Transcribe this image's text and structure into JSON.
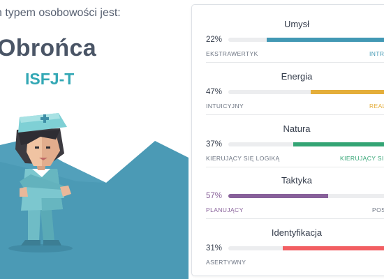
{
  "hero": {
    "intro": "n typem osobowości jest:",
    "type_name": "Obrońca",
    "type_code": "ISFJ-T"
  },
  "colors": {
    "teal": "#33a8b5",
    "blue": "#4298b4",
    "yellow": "#e4ae3a",
    "green": "#33a474",
    "purple": "#88619a",
    "red": "#f25e62"
  },
  "traits": [
    {
      "title": "Umysł",
      "percent": "22%",
      "value": 0.22,
      "left": "EKSTRAWERTYK",
      "right": "INTR",
      "color": "#4298b4",
      "active_side": "right"
    },
    {
      "title": "Energia",
      "percent": "47%",
      "value": 0.47,
      "left": "INTUICYJNY",
      "right": "REAL",
      "color": "#e4ae3a",
      "active_side": "right"
    },
    {
      "title": "Natura",
      "percent": "37%",
      "value": 0.37,
      "left": "KIERUJĄCY SIĘ LOGIKĄ",
      "right": "KIERUJĄCY SIĘ Z",
      "color": "#33a474",
      "active_side": "right"
    },
    {
      "title": "Taktyka",
      "percent": "57%",
      "value": 0.57,
      "left": "PLANUJĄCY",
      "right": "POSZ",
      "color": "#88619a",
      "active_side": "left"
    },
    {
      "title": "Identyfikacja",
      "percent": "31%",
      "value": 0.31,
      "left": "ASERTYWNY",
      "right": "",
      "color": "#f25e62",
      "active_side": "right"
    }
  ]
}
